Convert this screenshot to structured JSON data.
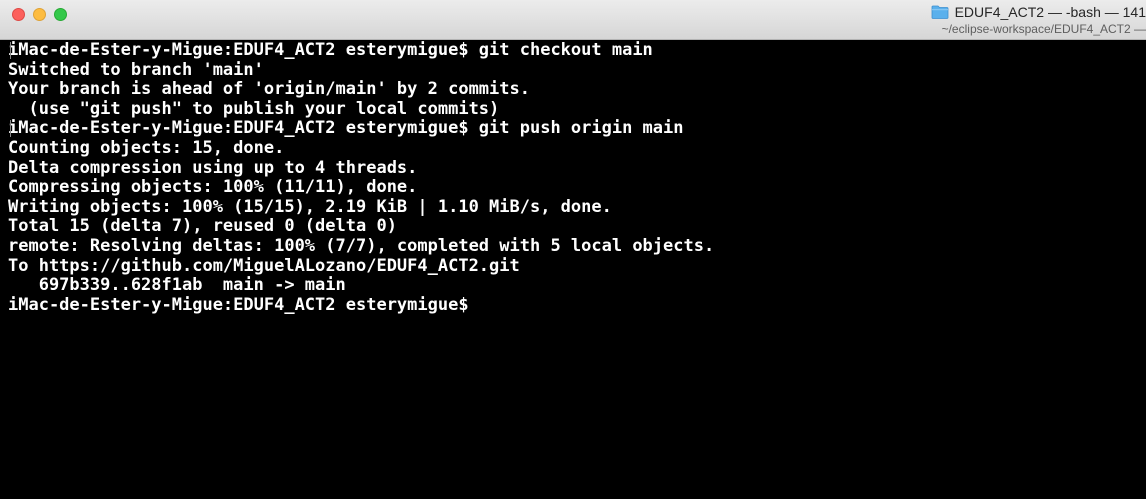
{
  "window": {
    "title": "EDUF4_ACT2 — -bash — 141",
    "subtitle": "~/eclipse-workspace/EDUF4_ACT2 —"
  },
  "colors": {
    "terminal_bg": "#000000",
    "terminal_fg": "#ffffff",
    "folder": "#5ab0ec"
  },
  "icons": {
    "folder": "folder-icon"
  },
  "terminal": {
    "lines": [
      "iMac-de-Ester-y-Migue:EDUF4_ACT2 esterymigue$ git checkout main",
      "Switched to branch 'main'",
      "Your branch is ahead of 'origin/main' by 2 commits.",
      "  (use \"git push\" to publish your local commits)",
      "iMac-de-Ester-y-Migue:EDUF4_ACT2 esterymigue$ git push origin main",
      "Counting objects: 15, done.",
      "Delta compression using up to 4 threads.",
      "Compressing objects: 100% (11/11), done.",
      "Writing objects: 100% (15/15), 2.19 KiB | 1.10 MiB/s, done.",
      "Total 15 (delta 7), reused 0 (delta 0)",
      "remote: Resolving deltas: 100% (7/7), completed with 5 local objects.",
      "To https://github.com/MiguelALozano/EDUF4_ACT2.git",
      "   697b339..628f1ab  main -> main",
      "iMac-de-Ester-y-Migue:EDUF4_ACT2 esterymigue$"
    ]
  }
}
